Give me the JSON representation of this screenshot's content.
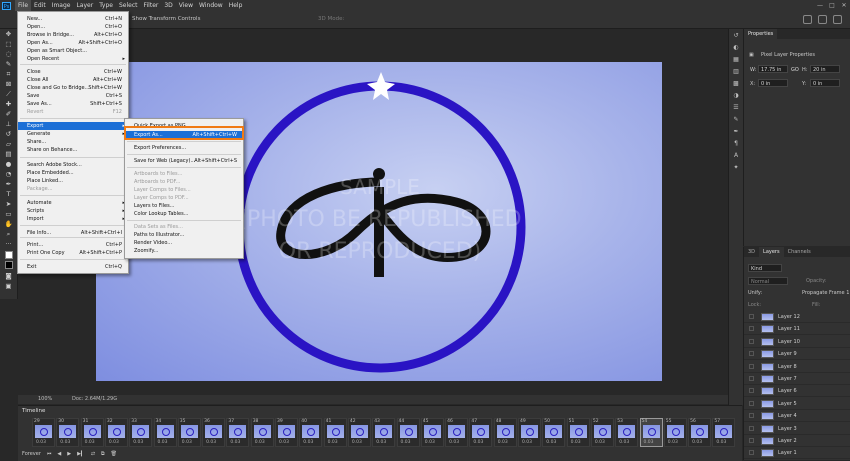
{
  "menubar": {
    "logo": "Ps",
    "items": [
      "File",
      "Edit",
      "Image",
      "Layer",
      "Type",
      "Select",
      "Filter",
      "3D",
      "View",
      "Window",
      "Help"
    ]
  },
  "window_controls": [
    "—",
    "□",
    "✕"
  ],
  "optionsbar": {
    "transform_label": "Show Transform Controls",
    "mode_label": "3D Mode:"
  },
  "file_menu": {
    "items": [
      {
        "label": "New...",
        "shortcut": "Ctrl+N"
      },
      {
        "label": "Open...",
        "shortcut": "Ctrl+O"
      },
      {
        "label": "Browse in Bridge...",
        "shortcut": "Alt+Ctrl+O"
      },
      {
        "label": "Open As...",
        "shortcut": "Alt+Shift+Ctrl+O"
      },
      {
        "label": "Open as Smart Object...",
        "shortcut": ""
      },
      {
        "label": "Open Recent",
        "shortcut": ""
      },
      {
        "label": "Close",
        "shortcut": "Ctrl+W"
      },
      {
        "label": "Close All",
        "shortcut": "Alt+Ctrl+W"
      },
      {
        "label": "Close and Go to Bridge...",
        "shortcut": "Shift+Ctrl+W"
      },
      {
        "label": "Save",
        "shortcut": "Ctrl+S"
      },
      {
        "label": "Save As...",
        "shortcut": "Shift+Ctrl+S"
      },
      {
        "label": "Revert",
        "shortcut": "F12"
      },
      {
        "label": "Export",
        "shortcut": ""
      },
      {
        "label": "Generate",
        "shortcut": ""
      },
      {
        "label": "Share...",
        "shortcut": ""
      },
      {
        "label": "Share on Behance...",
        "shortcut": ""
      },
      {
        "label": "Search Adobe Stock...",
        "shortcut": ""
      },
      {
        "label": "Place Embedded...",
        "shortcut": ""
      },
      {
        "label": "Place Linked...",
        "shortcut": ""
      },
      {
        "label": "Package...",
        "shortcut": ""
      },
      {
        "label": "Automate",
        "shortcut": ""
      },
      {
        "label": "Scripts",
        "shortcut": ""
      },
      {
        "label": "Import",
        "shortcut": ""
      },
      {
        "label": "File Info...",
        "shortcut": "Alt+Shift+Ctrl+I"
      },
      {
        "label": "Print...",
        "shortcut": "Ctrl+P"
      },
      {
        "label": "Print One Copy",
        "shortcut": "Alt+Shift+Ctrl+P"
      },
      {
        "label": "Exit",
        "shortcut": "Ctrl+Q"
      }
    ]
  },
  "export_menu": {
    "items": [
      {
        "label": "Quick Export as PNG",
        "shortcut": ""
      },
      {
        "label": "Export As...",
        "shortcut": "Alt+Shift+Ctrl+W"
      },
      {
        "label": "Export Preferences...",
        "shortcut": ""
      },
      {
        "label": "Save for Web (Legacy)...",
        "shortcut": "Alt+Shift+Ctrl+S"
      },
      {
        "label": "Artboards to Files...",
        "shortcut": ""
      },
      {
        "label": "Artboards to PDF...",
        "shortcut": ""
      },
      {
        "label": "Layer Comps to Files...",
        "shortcut": ""
      },
      {
        "label": "Layer Comps to PDF...",
        "shortcut": ""
      },
      {
        "label": "Layers to Files...",
        "shortcut": ""
      },
      {
        "label": "Color Lookup Tables...",
        "shortcut": ""
      },
      {
        "label": "Data Sets as Files...",
        "shortcut": ""
      },
      {
        "label": "Paths to Illustrator...",
        "shortcut": ""
      },
      {
        "label": "Render Video...",
        "shortcut": ""
      },
      {
        "label": "Zoomify...",
        "shortcut": ""
      }
    ]
  },
  "canvas": {
    "watermark_line1": "SAMPLE",
    "watermark_line2": "(PHOTO BE REPUBLISHED",
    "watermark_line3": "OR REPRODUCED)",
    "ring_color": "#2a14c4"
  },
  "status": {
    "zoom": "100%",
    "doc": "Doc: 2.64M/1.29G"
  },
  "timeline": {
    "title": "Timeline",
    "forever_label": "Forever",
    "frame_time": "0.03",
    "frames": [
      "29",
      "30",
      "31",
      "32",
      "33",
      "34",
      "35",
      "36",
      "37",
      "38",
      "39",
      "40",
      "41",
      "42",
      "43",
      "44",
      "45",
      "46",
      "47",
      "48",
      "49",
      "50",
      "51",
      "52",
      "53",
      "54",
      "55",
      "56",
      "57"
    ],
    "selected_frame": "54"
  },
  "properties": {
    "tab": "Properties",
    "section": "Pixel Layer Properties",
    "w_label": "W:",
    "w_value": "17.75 in",
    "link": "GO",
    "h_label": "H:",
    "h_value": "20 in",
    "x_label": "X:",
    "x_value": "0 in",
    "y_label": "Y:",
    "y_value": "0 in"
  },
  "layers_panel": {
    "tabs": [
      "3D",
      "Layers",
      "Channels"
    ],
    "kind_label": "Kind",
    "blend_mode": "Normal",
    "opacity_label": "Opacity:",
    "unify_label": "Unify:",
    "propagate_label": "Propagate Frame 1",
    "lock_label": "Lock:",
    "fill_label": "Fill:",
    "layers": [
      "Layer 12",
      "Layer 11",
      "Layer 10",
      "Layer 9",
      "Layer 8",
      "Layer 7",
      "Layer 6",
      "Layer 5",
      "Layer 4",
      "Layer 3",
      "Layer 2",
      "Layer 1"
    ]
  }
}
